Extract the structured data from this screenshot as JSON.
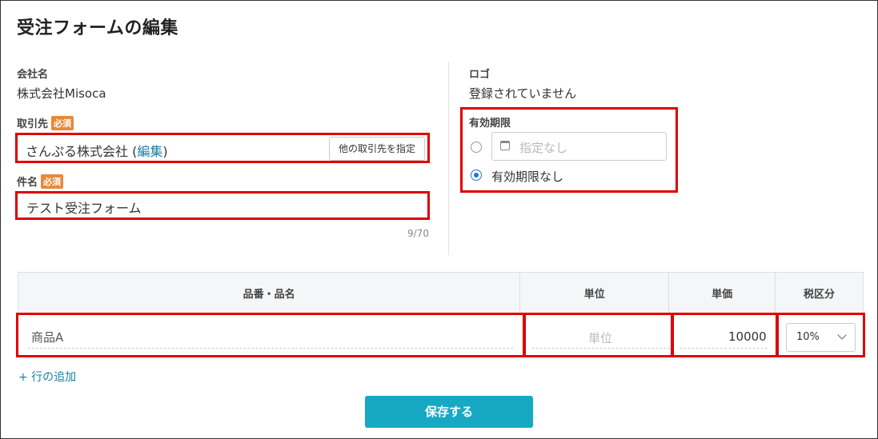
{
  "page_title": "受注フォームの編集",
  "company": {
    "label": "会社名",
    "value": "株式会社Misoca"
  },
  "logo": {
    "label": "ロゴ",
    "value": "登録されていません"
  },
  "client": {
    "label": "取引先",
    "required_badge": "必須",
    "name": "さんぷる株式会社",
    "paren_open": " (",
    "edit_link": "編集",
    "paren_close": ")",
    "other_button": "他の取引先を指定"
  },
  "subject": {
    "label": "件名",
    "required_badge": "必須",
    "value": "テスト受注フォーム",
    "counter": "9/70"
  },
  "expiry": {
    "label": "有効期限",
    "date_placeholder": "指定なし",
    "no_expiry_label": "有効期限なし",
    "selected": "no_expiry"
  },
  "table": {
    "headers": [
      "品番・品名",
      "単位",
      "単価",
      "税区分"
    ],
    "row": {
      "item_name": "商品A",
      "unit_placeholder": "単位",
      "unit_price": "10000",
      "tax": "10%"
    }
  },
  "add_row": "+ 行の追加",
  "save_button": "保存する",
  "colors": {
    "accent": "#17a9c3",
    "link": "#1a7fa8",
    "required_badge": "#e8893a",
    "highlight_box": "#e00000",
    "radio_checked": "#2672d6"
  }
}
